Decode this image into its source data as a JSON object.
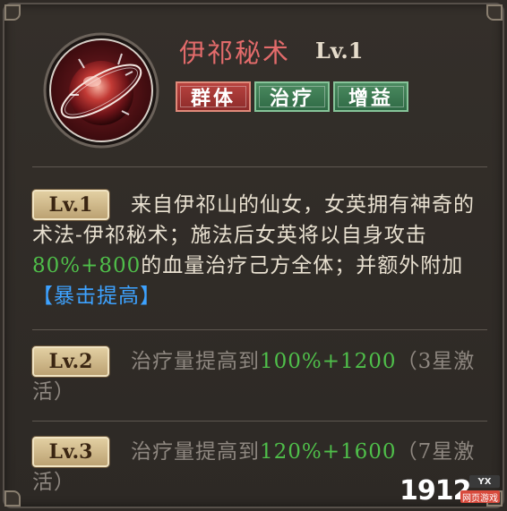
{
  "skill": {
    "name": "伊祁秘术",
    "level": "Lv.1",
    "tags": [
      "群体",
      "治疗",
      "增益"
    ]
  },
  "levels": [
    {
      "badge": "Lv.1",
      "segments": [
        "来自伊祁山的仙女，女英拥有神奇的术法-伊祁秘术；施法后女英将以自身攻击",
        "80%+800",
        "的血量治疗己方全体；并额外附加",
        "【暴击提高】"
      ]
    },
    {
      "badge": "Lv.2",
      "segments": [
        "治疗量提高到",
        "100%+1200",
        "（3星激活）"
      ]
    },
    {
      "badge": "Lv.3",
      "segments": [
        "治疗量提高到",
        "120%+1600",
        "（7星激活）"
      ]
    }
  ],
  "watermark": {
    "number": "1912",
    "tag": "YX",
    "sub": "网页游戏"
  }
}
